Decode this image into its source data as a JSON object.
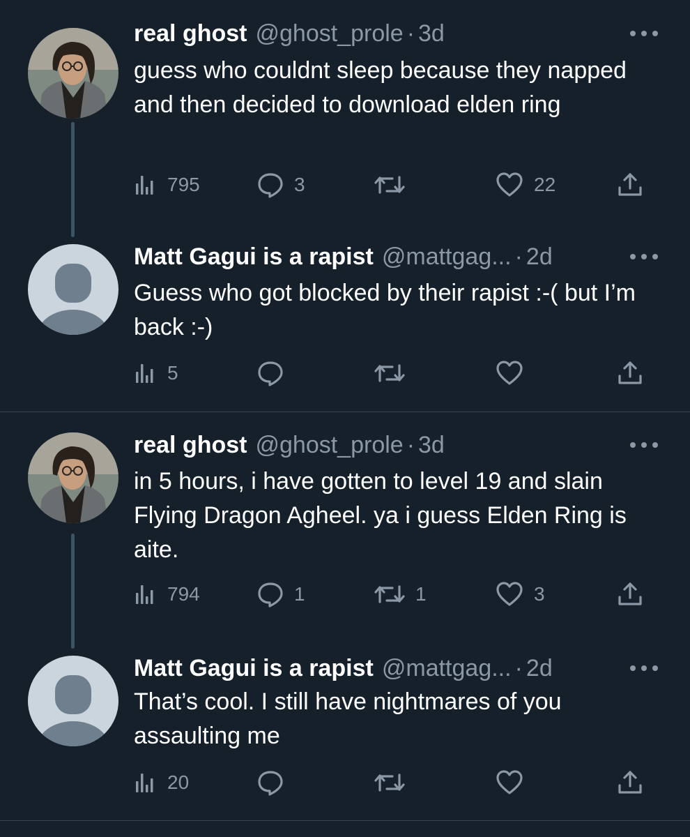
{
  "tweets": [
    {
      "display_name": "real ghost",
      "handle": "@ghost_prole",
      "separator": "·",
      "time": "3d",
      "text": "guess who couldnt sleep because they napped and then decided to download elden ring",
      "stats": {
        "views": "795",
        "replies": "3",
        "retweets": "",
        "likes": "22"
      }
    },
    {
      "display_name": "Matt Gagui is a rapist",
      "handle": "@mattgag...",
      "separator": "·",
      "time": "2d",
      "text": "Guess who got blocked by their rapist :-( but I’m back :-)",
      "stats": {
        "views": "5",
        "replies": "",
        "retweets": "",
        "likes": ""
      }
    },
    {
      "display_name": "real ghost",
      "handle": "@ghost_prole",
      "separator": "·",
      "time": "3d",
      "text": "in 5 hours, i have gotten to level 19 and slain Flying Dragon Agheel. ya i guess Elden Ring is aite.",
      "stats": {
        "views": "794",
        "replies": "1",
        "retweets": "1",
        "likes": "3"
      }
    },
    {
      "display_name": "Matt Gagui is a rapist",
      "handle": "@mattgag...",
      "separator": "·",
      "time": "2d",
      "text": "That’s cool. I still have nightmares of you assaulting me",
      "stats": {
        "views": "20",
        "replies": "",
        "retweets": "",
        "likes": ""
      }
    }
  ],
  "icons": {
    "views": "bar-chart-icon",
    "reply": "reply-bubble-icon",
    "retweet": "retweet-arrows-icon",
    "like": "heart-icon",
    "share": "share-upload-icon",
    "more": "more-dots-icon"
  },
  "colors": {
    "background": "#15202b",
    "text": "#ffffff",
    "secondary_text": "#8b98a5",
    "thread_line": "#3d5466",
    "divider": "#38444d",
    "default_avatar_bg": "#cbd5de",
    "default_avatar_fg": "#6f7f8d"
  }
}
